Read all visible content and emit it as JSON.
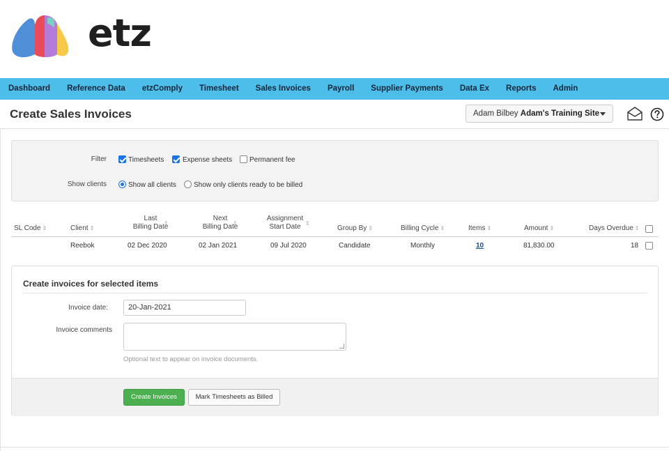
{
  "brand": {
    "logo_text": "etz"
  },
  "nav": {
    "items": [
      {
        "label": "Dashboard"
      },
      {
        "label": "Reference Data"
      },
      {
        "label": "etzComply"
      },
      {
        "label": "Timesheet"
      },
      {
        "label": "Sales Invoices"
      },
      {
        "label": "Payroll"
      },
      {
        "label": "Supplier Payments"
      },
      {
        "label": "Data Ex"
      },
      {
        "label": "Reports"
      },
      {
        "label": "Admin"
      }
    ]
  },
  "header": {
    "title": "Create Sales Invoices",
    "user_name": "Adam Bilbey",
    "site_name": "Adam's Training Site"
  },
  "filter": {
    "filter_label": "Filter",
    "options": [
      {
        "label": "Timesheets",
        "checked": true
      },
      {
        "label": "Expense sheets",
        "checked": true
      },
      {
        "label": "Permanent fee",
        "checked": false
      }
    ],
    "show_clients_label": "Show clients",
    "radio_options": [
      {
        "label": "Show all clients",
        "selected": true
      },
      {
        "label": "Show only clients ready to be billed",
        "selected": false
      }
    ]
  },
  "table": {
    "headers": {
      "sl_code": "SL Code",
      "client": "Client",
      "last_billing_1": "Last",
      "last_billing_2": "Billing Date",
      "next_billing_1": "Next",
      "next_billing_2": "Billing Date",
      "assignment_1": "Assignment",
      "assignment_2": "Start Date",
      "group_by": "Group By",
      "billing_cycle": "Billing Cycle",
      "items": "Items",
      "amount": "Amount",
      "days_overdue": "Days Overdue"
    },
    "rows": [
      {
        "sl_code": "",
        "client": "Reebok",
        "last_billing": "02 Dec 2020",
        "next_billing": "02 Jan 2021",
        "assignment_start": "09 Jul 2020",
        "group_by": "Candidate",
        "billing_cycle": "Monthly",
        "items": "10",
        "amount": "81,830.00",
        "days_overdue": "18",
        "selected": false
      }
    ]
  },
  "create": {
    "title": "Create invoices for selected items",
    "date_label": "Invoice date:",
    "date_value": "20-Jan-2021",
    "comments_label": "Invoice comments",
    "comments_value": "",
    "hint": "Optional text to appear on invoice documents.",
    "create_button": "Create Invoices",
    "mark_button": "Mark Timesheets as Billed"
  },
  "colors": {
    "nav_bg": "#4dbde9",
    "accent": "#1a73e8",
    "create_button": "#4caf50"
  }
}
